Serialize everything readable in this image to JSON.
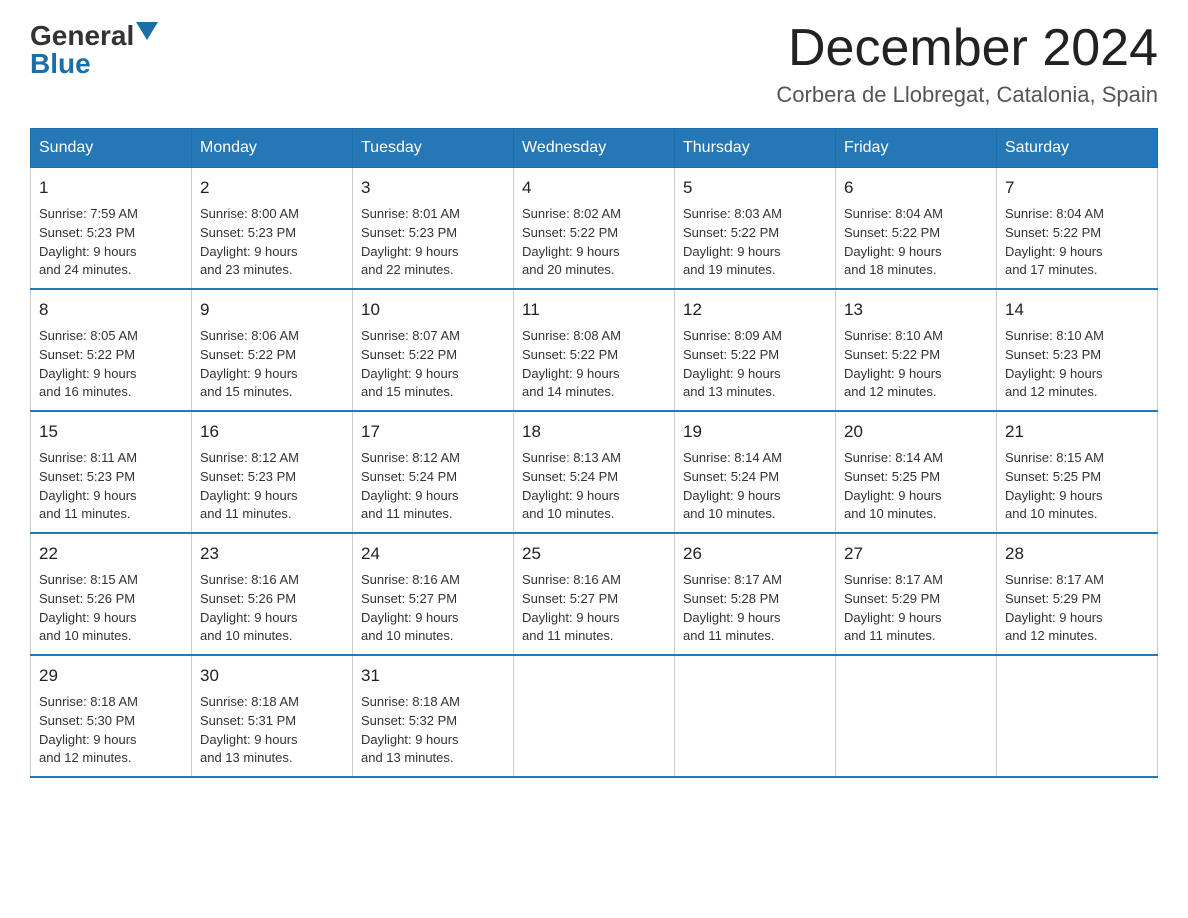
{
  "header": {
    "logo_general": "General",
    "logo_blue": "Blue",
    "title": "December 2024",
    "subtitle": "Corbera de Llobregat, Catalonia, Spain"
  },
  "days_of_week": [
    "Sunday",
    "Monday",
    "Tuesday",
    "Wednesday",
    "Thursday",
    "Friday",
    "Saturday"
  ],
  "weeks": [
    [
      {
        "day": "1",
        "sunrise": "7:59 AM",
        "sunset": "5:23 PM",
        "daylight": "9 hours and 24 minutes."
      },
      {
        "day": "2",
        "sunrise": "8:00 AM",
        "sunset": "5:23 PM",
        "daylight": "9 hours and 23 minutes."
      },
      {
        "day": "3",
        "sunrise": "8:01 AM",
        "sunset": "5:23 PM",
        "daylight": "9 hours and 22 minutes."
      },
      {
        "day": "4",
        "sunrise": "8:02 AM",
        "sunset": "5:22 PM",
        "daylight": "9 hours and 20 minutes."
      },
      {
        "day": "5",
        "sunrise": "8:03 AM",
        "sunset": "5:22 PM",
        "daylight": "9 hours and 19 minutes."
      },
      {
        "day": "6",
        "sunrise": "8:04 AM",
        "sunset": "5:22 PM",
        "daylight": "9 hours and 18 minutes."
      },
      {
        "day": "7",
        "sunrise": "8:04 AM",
        "sunset": "5:22 PM",
        "daylight": "9 hours and 17 minutes."
      }
    ],
    [
      {
        "day": "8",
        "sunrise": "8:05 AM",
        "sunset": "5:22 PM",
        "daylight": "9 hours and 16 minutes."
      },
      {
        "day": "9",
        "sunrise": "8:06 AM",
        "sunset": "5:22 PM",
        "daylight": "9 hours and 15 minutes."
      },
      {
        "day": "10",
        "sunrise": "8:07 AM",
        "sunset": "5:22 PM",
        "daylight": "9 hours and 15 minutes."
      },
      {
        "day": "11",
        "sunrise": "8:08 AM",
        "sunset": "5:22 PM",
        "daylight": "9 hours and 14 minutes."
      },
      {
        "day": "12",
        "sunrise": "8:09 AM",
        "sunset": "5:22 PM",
        "daylight": "9 hours and 13 minutes."
      },
      {
        "day": "13",
        "sunrise": "8:10 AM",
        "sunset": "5:22 PM",
        "daylight": "9 hours and 12 minutes."
      },
      {
        "day": "14",
        "sunrise": "8:10 AM",
        "sunset": "5:23 PM",
        "daylight": "9 hours and 12 minutes."
      }
    ],
    [
      {
        "day": "15",
        "sunrise": "8:11 AM",
        "sunset": "5:23 PM",
        "daylight": "9 hours and 11 minutes."
      },
      {
        "day": "16",
        "sunrise": "8:12 AM",
        "sunset": "5:23 PM",
        "daylight": "9 hours and 11 minutes."
      },
      {
        "day": "17",
        "sunrise": "8:12 AM",
        "sunset": "5:24 PM",
        "daylight": "9 hours and 11 minutes."
      },
      {
        "day": "18",
        "sunrise": "8:13 AM",
        "sunset": "5:24 PM",
        "daylight": "9 hours and 10 minutes."
      },
      {
        "day": "19",
        "sunrise": "8:14 AM",
        "sunset": "5:24 PM",
        "daylight": "9 hours and 10 minutes."
      },
      {
        "day": "20",
        "sunrise": "8:14 AM",
        "sunset": "5:25 PM",
        "daylight": "9 hours and 10 minutes."
      },
      {
        "day": "21",
        "sunrise": "8:15 AM",
        "sunset": "5:25 PM",
        "daylight": "9 hours and 10 minutes."
      }
    ],
    [
      {
        "day": "22",
        "sunrise": "8:15 AM",
        "sunset": "5:26 PM",
        "daylight": "9 hours and 10 minutes."
      },
      {
        "day": "23",
        "sunrise": "8:16 AM",
        "sunset": "5:26 PM",
        "daylight": "9 hours and 10 minutes."
      },
      {
        "day": "24",
        "sunrise": "8:16 AM",
        "sunset": "5:27 PM",
        "daylight": "9 hours and 10 minutes."
      },
      {
        "day": "25",
        "sunrise": "8:16 AM",
        "sunset": "5:27 PM",
        "daylight": "9 hours and 11 minutes."
      },
      {
        "day": "26",
        "sunrise": "8:17 AM",
        "sunset": "5:28 PM",
        "daylight": "9 hours and 11 minutes."
      },
      {
        "day": "27",
        "sunrise": "8:17 AM",
        "sunset": "5:29 PM",
        "daylight": "9 hours and 11 minutes."
      },
      {
        "day": "28",
        "sunrise": "8:17 AM",
        "sunset": "5:29 PM",
        "daylight": "9 hours and 12 minutes."
      }
    ],
    [
      {
        "day": "29",
        "sunrise": "8:18 AM",
        "sunset": "5:30 PM",
        "daylight": "9 hours and 12 minutes."
      },
      {
        "day": "30",
        "sunrise": "8:18 AM",
        "sunset": "5:31 PM",
        "daylight": "9 hours and 13 minutes."
      },
      {
        "day": "31",
        "sunrise": "8:18 AM",
        "sunset": "5:32 PM",
        "daylight": "9 hours and 13 minutes."
      },
      null,
      null,
      null,
      null
    ]
  ],
  "labels": {
    "sunrise": "Sunrise:",
    "sunset": "Sunset:",
    "daylight": "Daylight:"
  }
}
